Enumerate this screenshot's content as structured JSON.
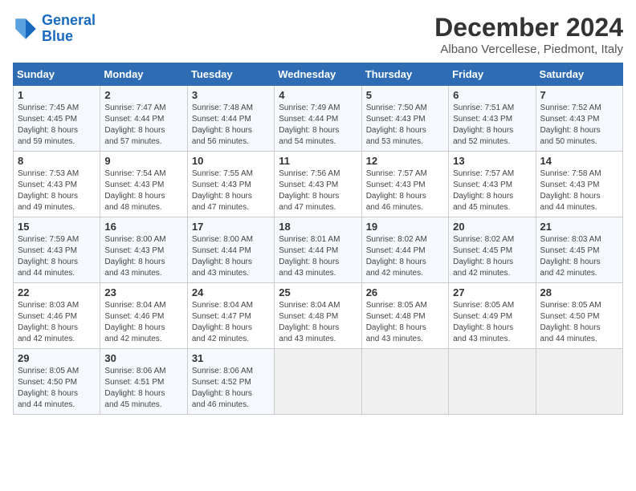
{
  "logo": {
    "line1": "General",
    "line2": "Blue"
  },
  "title": "December 2024",
  "subtitle": "Albano Vercellese, Piedmont, Italy",
  "days_of_week": [
    "Sunday",
    "Monday",
    "Tuesday",
    "Wednesday",
    "Thursday",
    "Friday",
    "Saturday"
  ],
  "weeks": [
    [
      {
        "day": "1",
        "info": "Sunrise: 7:45 AM\nSunset: 4:45 PM\nDaylight: 8 hours\nand 59 minutes."
      },
      {
        "day": "2",
        "info": "Sunrise: 7:47 AM\nSunset: 4:44 PM\nDaylight: 8 hours\nand 57 minutes."
      },
      {
        "day": "3",
        "info": "Sunrise: 7:48 AM\nSunset: 4:44 PM\nDaylight: 8 hours\nand 56 minutes."
      },
      {
        "day": "4",
        "info": "Sunrise: 7:49 AM\nSunset: 4:44 PM\nDaylight: 8 hours\nand 54 minutes."
      },
      {
        "day": "5",
        "info": "Sunrise: 7:50 AM\nSunset: 4:43 PM\nDaylight: 8 hours\nand 53 minutes."
      },
      {
        "day": "6",
        "info": "Sunrise: 7:51 AM\nSunset: 4:43 PM\nDaylight: 8 hours\nand 52 minutes."
      },
      {
        "day": "7",
        "info": "Sunrise: 7:52 AM\nSunset: 4:43 PM\nDaylight: 8 hours\nand 50 minutes."
      }
    ],
    [
      {
        "day": "8",
        "info": "Sunrise: 7:53 AM\nSunset: 4:43 PM\nDaylight: 8 hours\nand 49 minutes."
      },
      {
        "day": "9",
        "info": "Sunrise: 7:54 AM\nSunset: 4:43 PM\nDaylight: 8 hours\nand 48 minutes."
      },
      {
        "day": "10",
        "info": "Sunrise: 7:55 AM\nSunset: 4:43 PM\nDaylight: 8 hours\nand 47 minutes."
      },
      {
        "day": "11",
        "info": "Sunrise: 7:56 AM\nSunset: 4:43 PM\nDaylight: 8 hours\nand 47 minutes."
      },
      {
        "day": "12",
        "info": "Sunrise: 7:57 AM\nSunset: 4:43 PM\nDaylight: 8 hours\nand 46 minutes."
      },
      {
        "day": "13",
        "info": "Sunrise: 7:57 AM\nSunset: 4:43 PM\nDaylight: 8 hours\nand 45 minutes."
      },
      {
        "day": "14",
        "info": "Sunrise: 7:58 AM\nSunset: 4:43 PM\nDaylight: 8 hours\nand 44 minutes."
      }
    ],
    [
      {
        "day": "15",
        "info": "Sunrise: 7:59 AM\nSunset: 4:43 PM\nDaylight: 8 hours\nand 44 minutes."
      },
      {
        "day": "16",
        "info": "Sunrise: 8:00 AM\nSunset: 4:43 PM\nDaylight: 8 hours\nand 43 minutes."
      },
      {
        "day": "17",
        "info": "Sunrise: 8:00 AM\nSunset: 4:44 PM\nDaylight: 8 hours\nand 43 minutes."
      },
      {
        "day": "18",
        "info": "Sunrise: 8:01 AM\nSunset: 4:44 PM\nDaylight: 8 hours\nand 43 minutes."
      },
      {
        "day": "19",
        "info": "Sunrise: 8:02 AM\nSunset: 4:44 PM\nDaylight: 8 hours\nand 42 minutes."
      },
      {
        "day": "20",
        "info": "Sunrise: 8:02 AM\nSunset: 4:45 PM\nDaylight: 8 hours\nand 42 minutes."
      },
      {
        "day": "21",
        "info": "Sunrise: 8:03 AM\nSunset: 4:45 PM\nDaylight: 8 hours\nand 42 minutes."
      }
    ],
    [
      {
        "day": "22",
        "info": "Sunrise: 8:03 AM\nSunset: 4:46 PM\nDaylight: 8 hours\nand 42 minutes."
      },
      {
        "day": "23",
        "info": "Sunrise: 8:04 AM\nSunset: 4:46 PM\nDaylight: 8 hours\nand 42 minutes."
      },
      {
        "day": "24",
        "info": "Sunrise: 8:04 AM\nSunset: 4:47 PM\nDaylight: 8 hours\nand 42 minutes."
      },
      {
        "day": "25",
        "info": "Sunrise: 8:04 AM\nSunset: 4:48 PM\nDaylight: 8 hours\nand 43 minutes."
      },
      {
        "day": "26",
        "info": "Sunrise: 8:05 AM\nSunset: 4:48 PM\nDaylight: 8 hours\nand 43 minutes."
      },
      {
        "day": "27",
        "info": "Sunrise: 8:05 AM\nSunset: 4:49 PM\nDaylight: 8 hours\nand 43 minutes."
      },
      {
        "day": "28",
        "info": "Sunrise: 8:05 AM\nSunset: 4:50 PM\nDaylight: 8 hours\nand 44 minutes."
      }
    ],
    [
      {
        "day": "29",
        "info": "Sunrise: 8:05 AM\nSunset: 4:50 PM\nDaylight: 8 hours\nand 44 minutes."
      },
      {
        "day": "30",
        "info": "Sunrise: 8:06 AM\nSunset: 4:51 PM\nDaylight: 8 hours\nand 45 minutes."
      },
      {
        "day": "31",
        "info": "Sunrise: 8:06 AM\nSunset: 4:52 PM\nDaylight: 8 hours\nand 46 minutes."
      },
      {
        "day": "",
        "info": ""
      },
      {
        "day": "",
        "info": ""
      },
      {
        "day": "",
        "info": ""
      },
      {
        "day": "",
        "info": ""
      }
    ]
  ]
}
